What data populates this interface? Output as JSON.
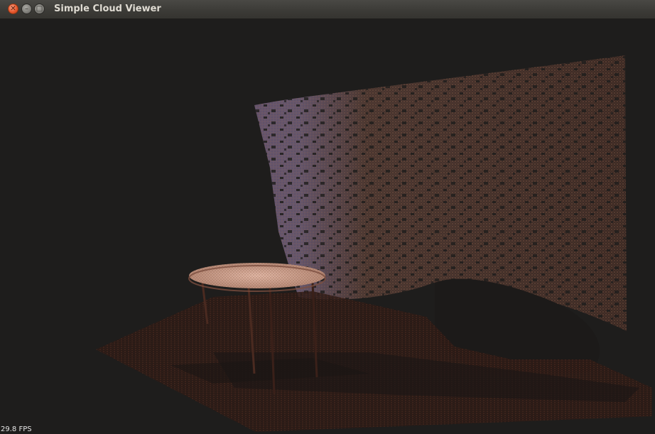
{
  "window": {
    "title": "Simple Cloud Viewer",
    "controls": {
      "close": "close-icon",
      "minimize": "minimize-icon",
      "maximize": "maximize-icon"
    }
  },
  "viewer": {
    "fps_text": "29.8 FPS",
    "background_color": "#1e1d1c",
    "scene_objects": [
      "back-wall",
      "floor",
      "round-table",
      "chair"
    ]
  }
}
